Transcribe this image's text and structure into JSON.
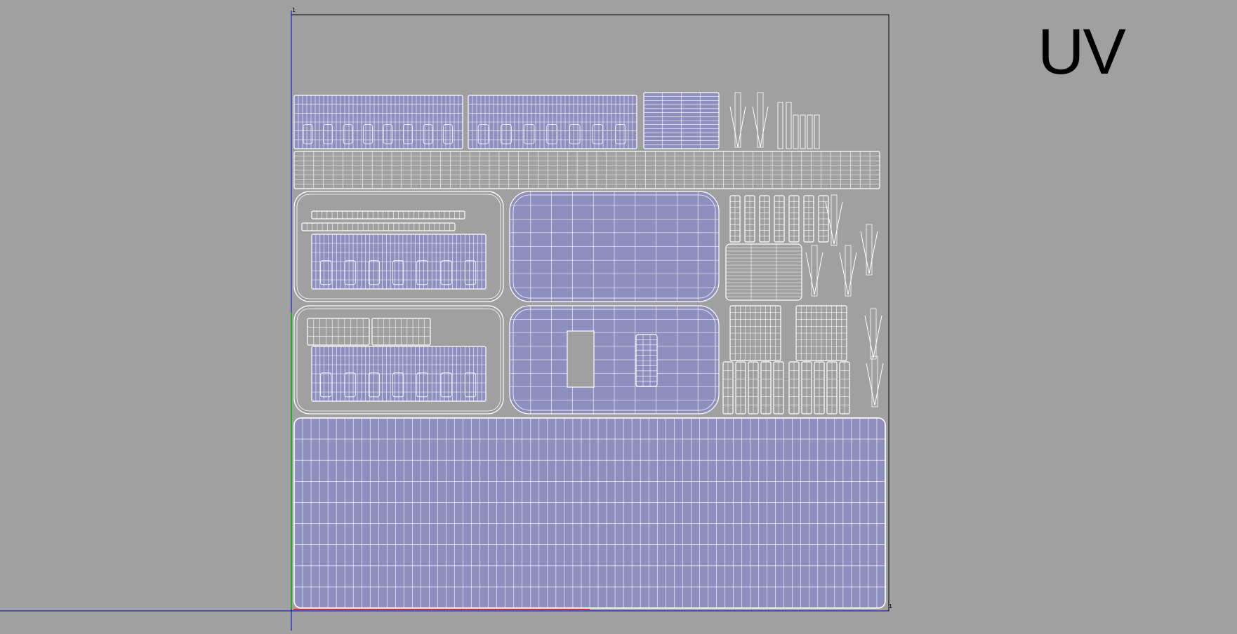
{
  "title": "UV",
  "corner_labels": {
    "top_left": "1",
    "bottom_right": "1"
  },
  "colors": {
    "background": "#a0a0a0",
    "uv_fill": "#8f8fbf",
    "wire": "#ffffff",
    "axis_u": "#0000cc",
    "axis_v": "#00aa00",
    "axis_u_red": "#cc3333",
    "frame": "#000000"
  }
}
